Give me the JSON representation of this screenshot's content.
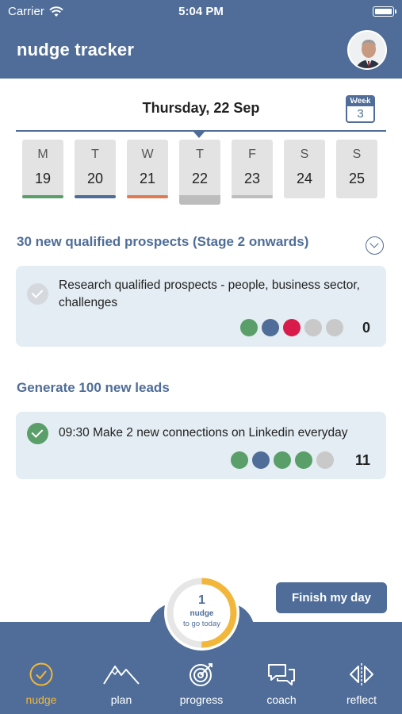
{
  "status_bar": {
    "carrier": "Carrier",
    "time": "5:04 PM"
  },
  "header": {
    "title": "nudge tracker"
  },
  "calendar": {
    "date_title": "Thursday, 22 Sep",
    "week_label": "Week",
    "week_number": "3",
    "days": [
      {
        "letter": "M",
        "number": "19",
        "bar_color": "#5a9e6a"
      },
      {
        "letter": "T",
        "number": "20",
        "bar_color": "#4f6d98"
      },
      {
        "letter": "W",
        "number": "21",
        "bar_color": "#e07a50"
      },
      {
        "letter": "T",
        "number": "22",
        "bar_color": "#bdbdbd",
        "active": true
      },
      {
        "letter": "F",
        "number": "23",
        "bar_color": "#bdbdbd"
      },
      {
        "letter": "S",
        "number": "24",
        "bar_color": null
      },
      {
        "letter": "S",
        "number": "25",
        "bar_color": null
      }
    ]
  },
  "goals": [
    {
      "title": "30 new qualified prospects (Stage 2 onwards)",
      "task": {
        "text": "Research qualified prospects - people, business sector, challenges",
        "done": false,
        "dots": [
          "#5a9e6a",
          "#4f6d98",
          "#d81b4a",
          "#c9c9c9",
          "#c9c9c9"
        ],
        "count": "0"
      }
    },
    {
      "title": "Generate 100 new leads",
      "task": {
        "text": "09:30 Make 2 new connections on Linkedin everyday",
        "done": true,
        "dots": [
          "#5a9e6a",
          "#4f6d98",
          "#5a9e6a",
          "#5a9e6a",
          "#c9c9c9"
        ],
        "count": "11"
      }
    }
  ],
  "finish_button": "Finish my day",
  "nudge_progress": {
    "count": "1",
    "label1": "nudge",
    "label2": "to go today",
    "fraction_complete": 0.5
  },
  "tabs": [
    {
      "label": "nudge",
      "icon": "check-circle-icon",
      "active": true
    },
    {
      "label": "plan",
      "icon": "mountain-icon"
    },
    {
      "label": "progress",
      "icon": "target-icon"
    },
    {
      "label": "coach",
      "icon": "chat-bubbles-icon"
    },
    {
      "label": "reflect",
      "icon": "mirror-icon"
    }
  ],
  "colors": {
    "brand": "#4f6d98",
    "accent": "#f2b73a",
    "card": "#e3edf3"
  }
}
